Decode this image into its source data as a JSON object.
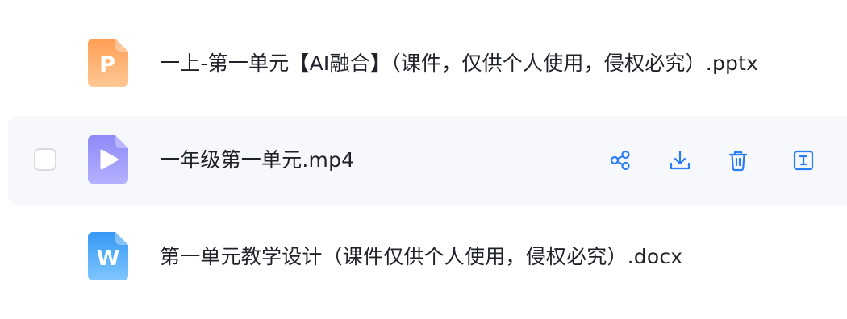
{
  "files": [
    {
      "name": "一上-第一单元【AI融合】（课件，仅供个人使用，侵权必究）.pptx",
      "icon": "pptx-file-icon",
      "icon_letter": "P",
      "colors": [
        "#ffa05a",
        "#ffc790"
      ]
    },
    {
      "name": "一年级第一单元.mp4",
      "icon": "video-file-icon",
      "colors": [
        "#8f8cf8",
        "#b3b0ff"
      ],
      "hovered": true
    },
    {
      "name": "第一单元教学设计（课件仅供个人使用，侵权必究）.docx",
      "icon": "docx-file-icon",
      "icon_letter": "W",
      "colors": [
        "#3b9cf5",
        "#7fc4ff"
      ]
    }
  ],
  "row_actions": [
    "share-icon",
    "download-icon",
    "delete-icon",
    "rename-icon",
    "more-icon"
  ],
  "accent_color": "#2b7df5"
}
